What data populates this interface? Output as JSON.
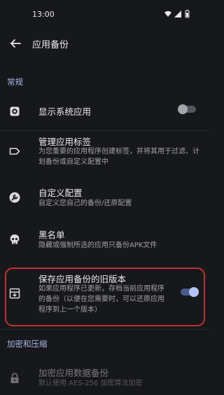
{
  "status_bar": {
    "time": "13:00"
  },
  "app_bar": {
    "title": "应用备份"
  },
  "sections": {
    "general": "常规",
    "encryption": "加密和压缩"
  },
  "settings": {
    "show_system_apps": {
      "title": "显示系统应用",
      "enabled": false
    },
    "manage_tags": {
      "title": "管理应用标签",
      "desc": "为您重要的应用程序创建标签，并将其用于过滤、计划备份或自定义配置中"
    },
    "custom_config": {
      "title": "自定义配置",
      "desc": "自定义您自己的备份/还原配置"
    },
    "blacklist": {
      "title": "黑名单",
      "desc": "隐藏或强制所选的应用只备份APK文件"
    },
    "keep_old_backup": {
      "title": "保存应用备份的旧版本",
      "desc": "如果应用程序已更新，存档当前应用程序的备份（以便在您需要时，可以还原应用程序到上一个版本）",
      "enabled": true
    },
    "encrypt_backup": {
      "title": "加密应用数据备份",
      "desc": "默认使用 AES-256 加密算法加密"
    }
  }
}
